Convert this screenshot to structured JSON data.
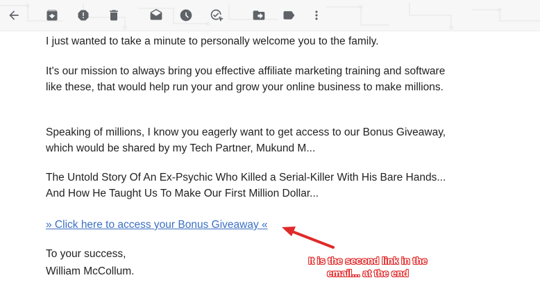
{
  "toolbar": {
    "icons": [
      {
        "name": "back-arrow-icon"
      },
      {
        "name": "archive-icon"
      },
      {
        "name": "report-spam-icon"
      },
      {
        "name": "delete-icon"
      },
      {
        "name": "mark-unread-icon"
      },
      {
        "name": "snooze-icon"
      },
      {
        "name": "add-to-tasks-icon"
      },
      {
        "name": "move-to-icon"
      },
      {
        "name": "label-icon"
      },
      {
        "name": "more-options-icon"
      }
    ]
  },
  "email": {
    "paragraph1": "I just wanted to take a minute to personally welcome you to the family.",
    "paragraph2": "It's our mission to always bring you effective affiliate marketing training and software like these, that would help run your and grow your online business to make millions.",
    "paragraph3": "Speaking of millions, I know you eagerly want to get access to our Bonus Giveaway, which would be shared by my Tech Partner, Mukund M...",
    "paragraph4": "The Untold Story Of An Ex-Psychic Who Killed a Serial-Killer With His Bare Hands... And How He Taught Us To Make Our First Million Dollar...",
    "link_text": "» Click here to access your Bonus Giveaway «",
    "closing": "To your success,",
    "signature": "William McCollum."
  },
  "annotation": {
    "line1": "It is the second link in the",
    "line2": "email... at the end",
    "color": "#e02a2a"
  },
  "colors": {
    "link": "#3b6fc4",
    "icon": "#5f6368",
    "toolbar_bg": "#f7f7f7"
  }
}
